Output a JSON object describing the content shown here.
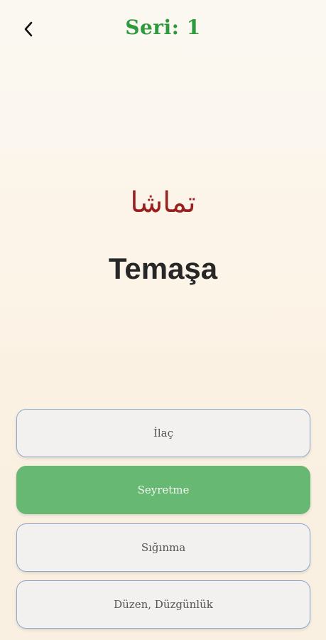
{
  "header": {
    "title": "Seri: 1",
    "back_icon": "chevron-left-icon"
  },
  "card": {
    "arabic": "تماشا",
    "word": "Temaşa"
  },
  "options": [
    {
      "label": "İlaç",
      "selected": false
    },
    {
      "label": "Seyretme",
      "selected": true
    },
    {
      "label": "Sığınma",
      "selected": false
    },
    {
      "label": "Düzen, Düzgünlük",
      "selected": false
    }
  ],
  "colors": {
    "title": "#2e9a3e",
    "arabic": "#9a1f1f",
    "selected_option": "#66b872",
    "option_border": "#8aa9cc"
  }
}
